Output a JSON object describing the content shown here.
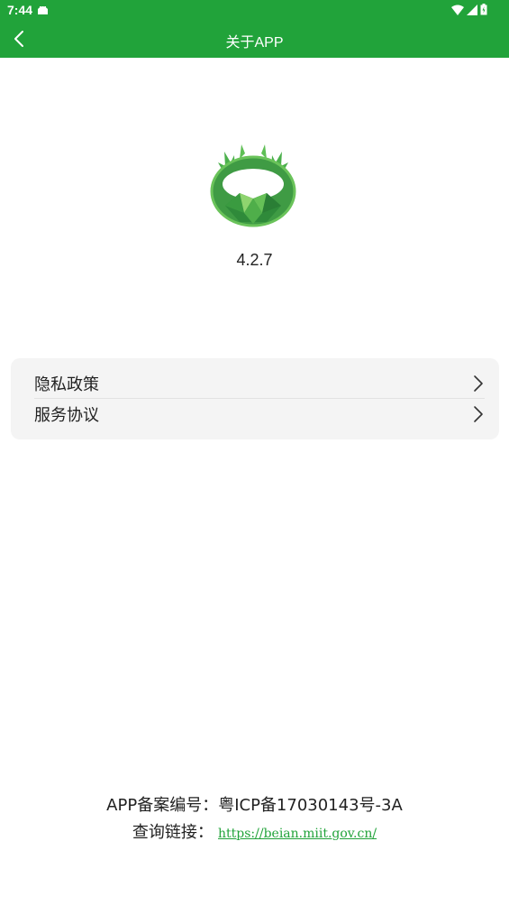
{
  "status_bar": {
    "time": "7:44",
    "icons": [
      "android-notification-icon",
      "wifi-icon",
      "signal-icon",
      "battery-icon"
    ]
  },
  "app_bar": {
    "title": "关于APP",
    "back_icon": "chevron-left-icon"
  },
  "app": {
    "logo_icon": "deer-antler-emerald-logo",
    "version": "4.2.7"
  },
  "menu": {
    "items": [
      {
        "label": "隐私政策",
        "icon": "chevron-right-icon"
      },
      {
        "label": "服务协议",
        "icon": "chevron-right-icon"
      }
    ]
  },
  "footer": {
    "record_label": "APP备案编号：粤ICP备17030143号-3A",
    "query_label": "查询链接：",
    "query_link": "https://beian.miit.gov.cn/"
  },
  "colors": {
    "brand_green": "#21a33a",
    "menu_bg": "#f4f4f4",
    "link": "#21a33a"
  }
}
